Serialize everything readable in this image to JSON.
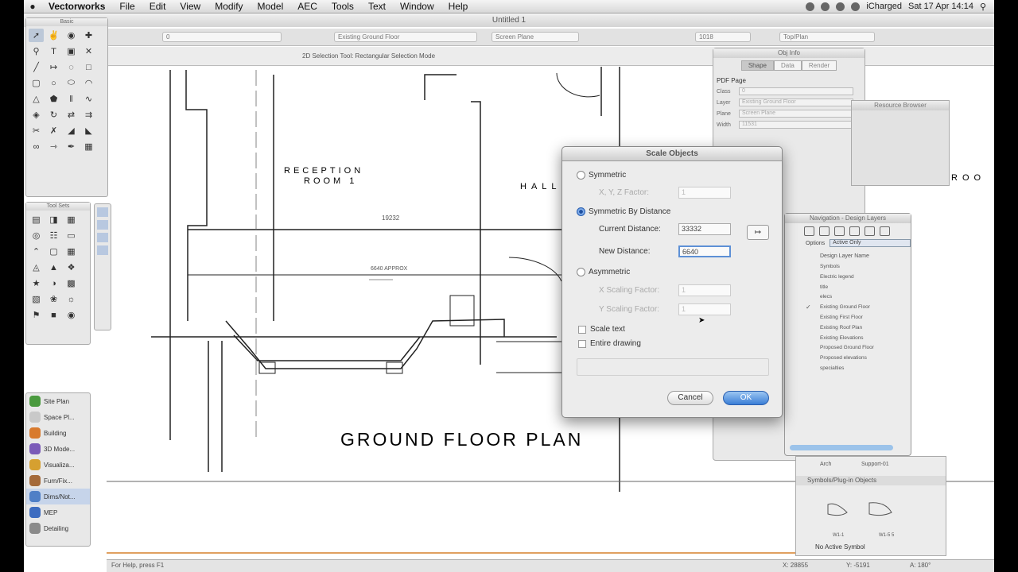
{
  "menubar": {
    "apple": "",
    "app": "Vectorworks",
    "items": [
      "File",
      "Edit",
      "View",
      "Modify",
      "Model",
      "AEC",
      "Tools",
      "Text",
      "Window",
      "Help"
    ],
    "user": "iCharged",
    "clock": "Sat 17 Apr  14:14"
  },
  "document": {
    "title": "Untitled 1"
  },
  "toolbar": {
    "class_field": "0",
    "layer_field": "Existing Ground Floor",
    "plane_field": "Screen Plane",
    "zoom_field": "1018",
    "view_field": "Top/Plan",
    "mode_text": "2D Selection Tool: Rectangular Selection Mode"
  },
  "palettes": {
    "basic": "Basic",
    "tool_sets": "Tool Sets"
  },
  "workspaces": [
    "Site Plan",
    "Space Pl...",
    "Building",
    "3D Mode...",
    "Visualiza...",
    "Furn/Fix...",
    "Dims/Not...",
    "MEP",
    "Detailing"
  ],
  "drawing": {
    "reception": "RECEPTION",
    "room": "ROOM 1",
    "hall": "HALL",
    "dim1": "19232",
    "dim2": "6640 APPROX",
    "title": "GROUND FLOOR PLAN",
    "fragment": "ROO"
  },
  "obj_info": {
    "title": "Obj Info",
    "tabs": [
      "Shape",
      "Data",
      "Render"
    ],
    "heading": "PDF Page",
    "rows": [
      {
        "label": "Class",
        "value": "0"
      },
      {
        "label": "Layer",
        "value": "Existing Ground Floor"
      },
      {
        "label": "Plane",
        "value": "Screen Plane"
      },
      {
        "label": "Width",
        "value": "11531"
      }
    ]
  },
  "resource_browser": {
    "title": "Resource Browser"
  },
  "navigation": {
    "title": "Navigation - Design Layers",
    "options_label": "Options",
    "options_value": "Active Only",
    "column_header": "Design Layer Name",
    "layers": [
      {
        "name": "Symbols",
        "active": false
      },
      {
        "name": "Electric legend",
        "active": false
      },
      {
        "name": "title",
        "active": false
      },
      {
        "name": "elecs",
        "active": false
      },
      {
        "name": "Existing Ground Floor",
        "active": true
      },
      {
        "name": "Existing First Floor",
        "active": false
      },
      {
        "name": "Existing Roof Plan",
        "active": false
      },
      {
        "name": "Existing Elevations",
        "active": false
      },
      {
        "name": "Proposed Ground Floor",
        "active": false
      },
      {
        "name": "Proposed elevations",
        "active": false
      },
      {
        "name": "specialties",
        "active": false
      }
    ]
  },
  "symbols": {
    "col1": "Arch",
    "col2": "Support-01",
    "heading": "Symbols/Plug-in Objects",
    "footer": "No Active Symbol",
    "sym1": "W1-1",
    "sym2": "W1-5 5"
  },
  "dialog": {
    "title": "Scale Objects",
    "symmetric": "Symmetric",
    "xyz_label": "X, Y, Z Factor:",
    "xyz_value": "1",
    "by_distance": "Symmetric By Distance",
    "current_label": "Current Distance:",
    "current_value": "33332",
    "new_label": "New Distance:",
    "new_value": "6640",
    "asymmetric": "Asymmetric",
    "x_label": "X Scaling Factor:",
    "x_value": "1",
    "y_label": "Y Scaling Factor:",
    "y_value": "1",
    "scale_text": "Scale text",
    "entire": "Entire drawing",
    "cancel": "Cancel",
    "ok": "OK"
  },
  "status": {
    "left": "For Help, press F1",
    "x": "X: 28855",
    "y": "Y: -5191",
    "a": "A: 180°"
  }
}
